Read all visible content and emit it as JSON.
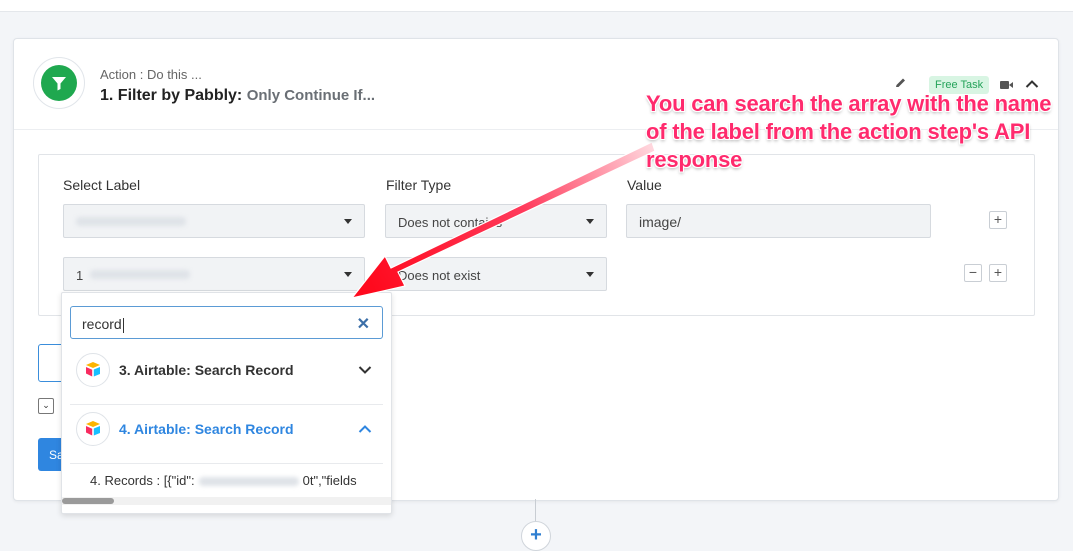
{
  "step": {
    "subtitle": "Action : Do this ...",
    "title": "1. Filter by Pabbly:",
    "title_suffix": "Only Continue If...",
    "badge": "Free Task"
  },
  "filter": {
    "headers": {
      "label": "Select Label",
      "type": "Filter Type",
      "value": "Value"
    },
    "rows": [
      {
        "label": "",
        "type": "Does not contains",
        "value": "image/"
      },
      {
        "label": "1",
        "type": "Does not exist",
        "value": ""
      }
    ]
  },
  "dropdown": {
    "search_value": "record",
    "groups": [
      {
        "name": "3. Airtable: Search Record",
        "expanded": false
      },
      {
        "name": "4. Airtable: Search Record",
        "expanded": true
      }
    ],
    "record_item": "4. Records : [{\"id\":",
    "record_item_tail": "0t\",\"fields"
  },
  "behind": {
    "save_text": "Sa"
  },
  "annotation": {
    "text": "You can search the array with the name of the label from the action step's API response"
  },
  "colors": {
    "accent": "#2f7fd1",
    "brand_green": "#1fa84f",
    "annotation": "#ff2a6d",
    "highlight_group": "#2f86e0"
  },
  "icons": [
    "filter-icon",
    "pencil-icon",
    "video-icon",
    "chevron-up-icon",
    "caret-down-icon",
    "plus-icon",
    "minus-icon",
    "close-icon",
    "airtable-icon",
    "chevron-down-icon"
  ]
}
